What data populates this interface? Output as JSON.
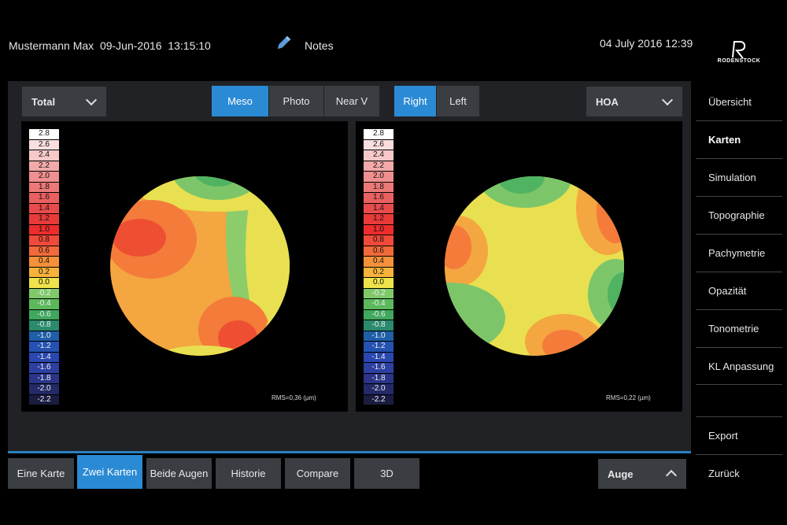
{
  "header": {
    "patient_name": "Mustermann Max",
    "patient_dob": "09-Jun-2016",
    "patient_time": "13:15:10",
    "notes_label": "Notes",
    "datetime": "04 July 2016 12:39",
    "logo_text": "RODENSTOCK"
  },
  "toolbar": {
    "left_select": "Total",
    "pupil_modes": [
      "Meso",
      "Photo",
      "Near V"
    ],
    "active_pupil_mode": "Meso",
    "eyes": [
      "Right",
      "Left"
    ],
    "active_eye": "Right",
    "right_select": "HOA"
  },
  "scale": {
    "values": [
      "2.8",
      "2.6",
      "2.4",
      "2.2",
      "2.0",
      "1.8",
      "1.6",
      "1.4",
      "1.2",
      "1.0",
      "0.8",
      "0.6",
      "0.4",
      "0.2",
      "0.0",
      "-0.2",
      "-0.4",
      "-0.6",
      "-0.8",
      "-1.0",
      "-1.2",
      "-1.4",
      "-1.6",
      "-1.8",
      "-2.0",
      "-2.2"
    ],
    "colors": [
      "#ffffff",
      "#f9dede",
      "#f6c8c8",
      "#f2a9a9",
      "#ef8f8f",
      "#ec7878",
      "#e96060",
      "#e84b4b",
      "#e93a3a",
      "#ec2d2d",
      "#ef4a3a",
      "#f26a3a",
      "#f5913a",
      "#f6b23a",
      "#efe24c",
      "#7fc96a",
      "#5cb85c",
      "#3fa85e",
      "#2b8a6e",
      "#1f5fa8",
      "#2552b2",
      "#2a47b0",
      "#2d3fa0",
      "#2a3588",
      "#232a66",
      "#1a1d40"
    ],
    "dark_text_until": 15
  },
  "maps": [
    {
      "rms": "RMS=0,36 (µm)"
    },
    {
      "rms": "RMS=0,22 (µm)"
    }
  ],
  "sidebar": {
    "items": [
      {
        "label": "Übersicht",
        "active": false
      },
      {
        "label": "Karten",
        "active": true
      },
      {
        "label": "Simulation",
        "active": false
      },
      {
        "label": "Topographie",
        "active": false
      },
      {
        "label": "Pachymetrie",
        "active": false
      },
      {
        "label": "Opazität",
        "active": false
      },
      {
        "label": "Tonometrie",
        "active": false
      },
      {
        "label": "KL Anpassung",
        "active": false
      }
    ],
    "export_label": "Export",
    "back_label": "Zurück"
  },
  "bottom": {
    "tabs": [
      {
        "label": "Eine Karte",
        "active": false
      },
      {
        "label": "Zwei Karten",
        "active": true
      },
      {
        "label": "Beide Augen",
        "active": false
      },
      {
        "label": "Historie",
        "active": false
      },
      {
        "label": "Compare",
        "active": false
      },
      {
        "label": "3D",
        "active": false
      }
    ],
    "eye_select": "Auge"
  }
}
